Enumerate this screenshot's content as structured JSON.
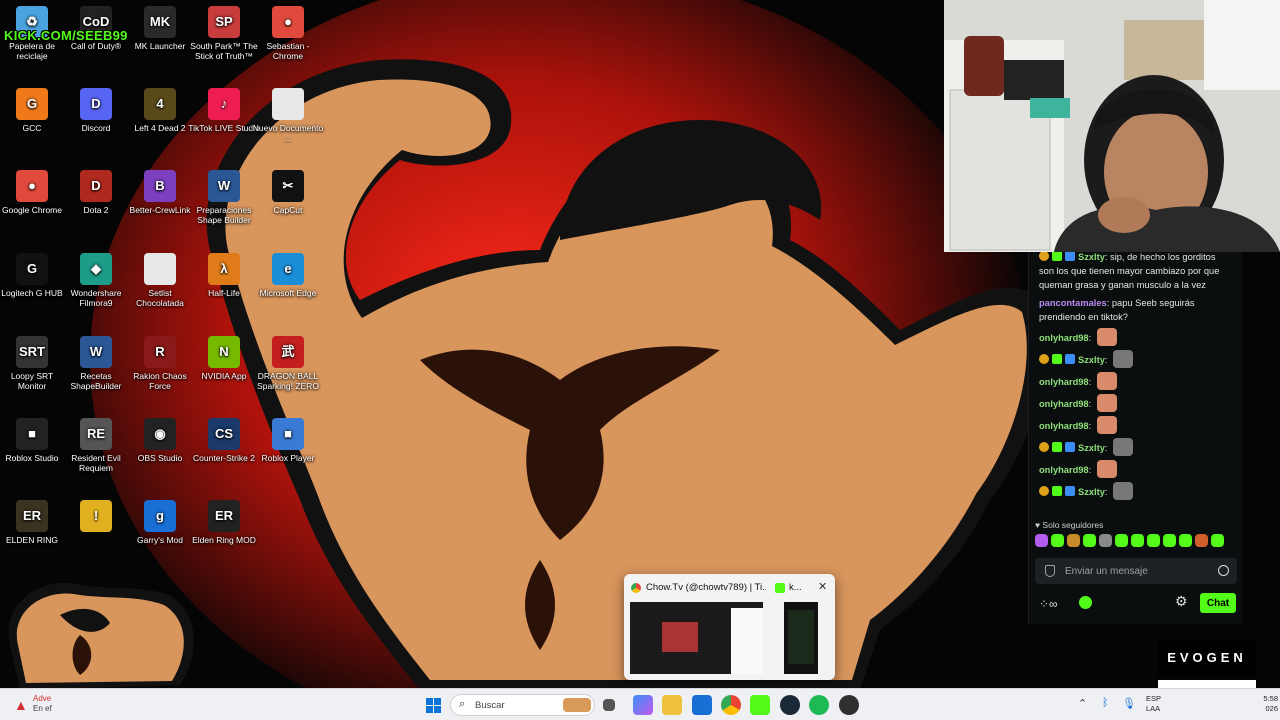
{
  "overlay": {
    "kick_handle": "KICK.COM/SEEB99",
    "brand_top": "EVOGEN",
    "brand_bottom": "EVOGEN"
  },
  "desktop": {
    "icons": [
      {
        "label": "Papelera de reciclaje",
        "color": "#4aa3df",
        "glyph": "♻"
      },
      {
        "label": "Call of Duty®",
        "color": "#222222",
        "glyph": "CoD"
      },
      {
        "label": "MK Launcher",
        "color": "#2a2a2a",
        "glyph": "MK"
      },
      {
        "label": "South Park™ The Stick of Truth™",
        "color": "#c83c3c",
        "glyph": "SP"
      },
      {
        "label": "Sebastian - Chrome",
        "color": "#e0493b",
        "glyph": "●"
      },
      {
        "label": "GCC",
        "color": "#f07a1a",
        "glyph": "G"
      },
      {
        "label": "Discord",
        "color": "#5865f2",
        "glyph": "D"
      },
      {
        "label": "Left 4 Dead 2",
        "color": "#5a4a1a",
        "glyph": "4"
      },
      {
        "label": "TikTok LIVE Studio",
        "color": "#ee1d52",
        "glyph": "♪"
      },
      {
        "label": "Nuevo Documento ...",
        "color": "#e8e8e8",
        "glyph": ""
      },
      {
        "label": "Google Chrome",
        "color": "#e0493b",
        "glyph": "●"
      },
      {
        "label": "Dota 2",
        "color": "#b0291e",
        "glyph": "D"
      },
      {
        "label": "Better-CrewLink",
        "color": "#7b3fbf",
        "glyph": "B"
      },
      {
        "label": "Preparaciones Shape Builder",
        "color": "#2b5797",
        "glyph": "W"
      },
      {
        "label": "CapCut",
        "color": "#111111",
        "glyph": "✂"
      },
      {
        "label": "Logitech G HUB",
        "color": "#111111",
        "glyph": "G"
      },
      {
        "label": "Wondershare Filmora9",
        "color": "#1e9c8a",
        "glyph": "◆"
      },
      {
        "label": "Setlist Chocolatada",
        "color": "#e8e8e8",
        "glyph": ""
      },
      {
        "label": "Half-Life",
        "color": "#e07b1a",
        "glyph": "λ"
      },
      {
        "label": "Microsoft Edge",
        "color": "#1a8fd8",
        "glyph": "e"
      },
      {
        "label": "Loopy SRT Monitor",
        "color": "#333333",
        "glyph": "SRT"
      },
      {
        "label": "Recetas ShapeBuilder",
        "color": "#2b5797",
        "glyph": "W"
      },
      {
        "label": "Rakion Chaos Force",
        "color": "#8a1a1a",
        "glyph": "R"
      },
      {
        "label": "NVIDIA App",
        "color": "#76b900",
        "glyph": "N"
      },
      {
        "label": "DRAGON BALL Sparking! ZERO",
        "color": "#c41e1e",
        "glyph": "武"
      },
      {
        "label": "Roblox Studio",
        "color": "#222222",
        "glyph": "■"
      },
      {
        "label": "Resident Evil Requiem",
        "color": "#555555",
        "glyph": "RE"
      },
      {
        "label": "OBS Studio",
        "color": "#222222",
        "glyph": "◉"
      },
      {
        "label": "Counter-Strike 2",
        "color": "#1b3a6b",
        "glyph": "CS"
      },
      {
        "label": "Roblox Player",
        "color": "#3a7bd5",
        "glyph": "■"
      },
      {
        "label": "ELDEN RING",
        "color": "#3a3320",
        "glyph": "ER"
      },
      {
        "label": "",
        "color": "#e0b020",
        "glyph": "!"
      },
      {
        "label": "Garry's Mod",
        "color": "#1a6fd6",
        "glyph": "g"
      },
      {
        "label": "Elden Ring MOD",
        "color": "#222222",
        "glyph": "ER"
      }
    ]
  },
  "chat": {
    "messages": [
      {
        "user": "Szxlty",
        "user_color": "#8ee07a",
        "text": "sip, de hecho los gorditos son los que tienen mayor cambiazo por que queman grasa y ganan musculo a la vez",
        "badges": true,
        "emote": false
      },
      {
        "user": "pancontamales",
        "user_color": "#b98cf5",
        "text": "papu Seeb seguirás prendiendo en tiktok?",
        "badges": false,
        "emote": false
      },
      {
        "user": "onlyhard98",
        "user_color": "#8ee07a",
        "text": "",
        "badges": false,
        "emote": true
      },
      {
        "user": "Szxlty",
        "user_color": "#8ee07a",
        "text": "",
        "badges": true,
        "emote": true
      },
      {
        "user": "onlyhard98",
        "user_color": "#8ee07a",
        "text": "",
        "badges": false,
        "emote": true
      },
      {
        "user": "onlyhard98",
        "user_color": "#8ee07a",
        "text": "",
        "badges": false,
        "emote": true
      },
      {
        "user": "onlyhard98",
        "user_color": "#8ee07a",
        "text": "",
        "badges": false,
        "emote": true
      },
      {
        "user": "Szxlty",
        "user_color": "#8ee07a",
        "text": "",
        "badges": true,
        "emote": true
      },
      {
        "user": "onlyhard98",
        "user_color": "#8ee07a",
        "text": "",
        "badges": false,
        "emote": true
      },
      {
        "user": "Szxlty",
        "user_color": "#8ee07a",
        "text": "",
        "badges": true,
        "emote": true
      }
    ],
    "followers_only": "Solo seguidores",
    "input_placeholder": "Enviar un mensaje",
    "send_label": "Chat",
    "accent": "#53fc18"
  },
  "preview": {
    "tab1_title": "Chow.Tv (@chowtv789) | Ti...",
    "tab2_title": "k..."
  },
  "taskbar": {
    "notification": {
      "title": "Adve",
      "subtitle": "En ef"
    },
    "search_label": "Buscar",
    "lang_top": "ESP",
    "lang_bottom": "LAA",
    "time": "5:58",
    "date_fragment": "026"
  }
}
